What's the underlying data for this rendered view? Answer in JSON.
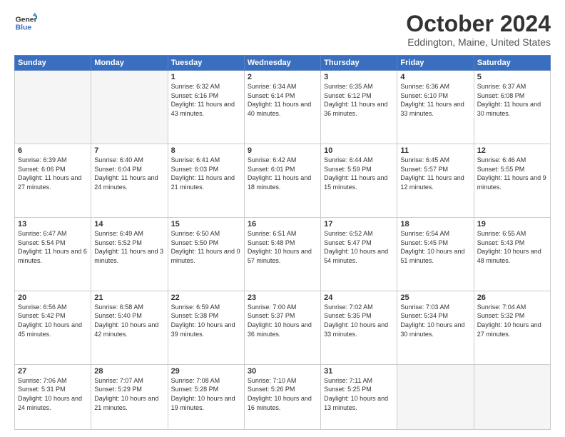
{
  "header": {
    "logo_line1": "General",
    "logo_line2": "Blue",
    "month": "October 2024",
    "location": "Eddington, Maine, United States"
  },
  "weekdays": [
    "Sunday",
    "Monday",
    "Tuesday",
    "Wednesday",
    "Thursday",
    "Friday",
    "Saturday"
  ],
  "weeks": [
    [
      {
        "day": "",
        "info": ""
      },
      {
        "day": "",
        "info": ""
      },
      {
        "day": "1",
        "info": "Sunrise: 6:32 AM\nSunset: 6:16 PM\nDaylight: 11 hours and 43 minutes."
      },
      {
        "day": "2",
        "info": "Sunrise: 6:34 AM\nSunset: 6:14 PM\nDaylight: 11 hours and 40 minutes."
      },
      {
        "day": "3",
        "info": "Sunrise: 6:35 AM\nSunset: 6:12 PM\nDaylight: 11 hours and 36 minutes."
      },
      {
        "day": "4",
        "info": "Sunrise: 6:36 AM\nSunset: 6:10 PM\nDaylight: 11 hours and 33 minutes."
      },
      {
        "day": "5",
        "info": "Sunrise: 6:37 AM\nSunset: 6:08 PM\nDaylight: 11 hours and 30 minutes."
      }
    ],
    [
      {
        "day": "6",
        "info": "Sunrise: 6:39 AM\nSunset: 6:06 PM\nDaylight: 11 hours and 27 minutes."
      },
      {
        "day": "7",
        "info": "Sunrise: 6:40 AM\nSunset: 6:04 PM\nDaylight: 11 hours and 24 minutes."
      },
      {
        "day": "8",
        "info": "Sunrise: 6:41 AM\nSunset: 6:03 PM\nDaylight: 11 hours and 21 minutes."
      },
      {
        "day": "9",
        "info": "Sunrise: 6:42 AM\nSunset: 6:01 PM\nDaylight: 11 hours and 18 minutes."
      },
      {
        "day": "10",
        "info": "Sunrise: 6:44 AM\nSunset: 5:59 PM\nDaylight: 11 hours and 15 minutes."
      },
      {
        "day": "11",
        "info": "Sunrise: 6:45 AM\nSunset: 5:57 PM\nDaylight: 11 hours and 12 minutes."
      },
      {
        "day": "12",
        "info": "Sunrise: 6:46 AM\nSunset: 5:55 PM\nDaylight: 11 hours and 9 minutes."
      }
    ],
    [
      {
        "day": "13",
        "info": "Sunrise: 6:47 AM\nSunset: 5:54 PM\nDaylight: 11 hours and 6 minutes."
      },
      {
        "day": "14",
        "info": "Sunrise: 6:49 AM\nSunset: 5:52 PM\nDaylight: 11 hours and 3 minutes."
      },
      {
        "day": "15",
        "info": "Sunrise: 6:50 AM\nSunset: 5:50 PM\nDaylight: 11 hours and 0 minutes."
      },
      {
        "day": "16",
        "info": "Sunrise: 6:51 AM\nSunset: 5:48 PM\nDaylight: 10 hours and 57 minutes."
      },
      {
        "day": "17",
        "info": "Sunrise: 6:52 AM\nSunset: 5:47 PM\nDaylight: 10 hours and 54 minutes."
      },
      {
        "day": "18",
        "info": "Sunrise: 6:54 AM\nSunset: 5:45 PM\nDaylight: 10 hours and 51 minutes."
      },
      {
        "day": "19",
        "info": "Sunrise: 6:55 AM\nSunset: 5:43 PM\nDaylight: 10 hours and 48 minutes."
      }
    ],
    [
      {
        "day": "20",
        "info": "Sunrise: 6:56 AM\nSunset: 5:42 PM\nDaylight: 10 hours and 45 minutes."
      },
      {
        "day": "21",
        "info": "Sunrise: 6:58 AM\nSunset: 5:40 PM\nDaylight: 10 hours and 42 minutes."
      },
      {
        "day": "22",
        "info": "Sunrise: 6:59 AM\nSunset: 5:38 PM\nDaylight: 10 hours and 39 minutes."
      },
      {
        "day": "23",
        "info": "Sunrise: 7:00 AM\nSunset: 5:37 PM\nDaylight: 10 hours and 36 minutes."
      },
      {
        "day": "24",
        "info": "Sunrise: 7:02 AM\nSunset: 5:35 PM\nDaylight: 10 hours and 33 minutes."
      },
      {
        "day": "25",
        "info": "Sunrise: 7:03 AM\nSunset: 5:34 PM\nDaylight: 10 hours and 30 minutes."
      },
      {
        "day": "26",
        "info": "Sunrise: 7:04 AM\nSunset: 5:32 PM\nDaylight: 10 hours and 27 minutes."
      }
    ],
    [
      {
        "day": "27",
        "info": "Sunrise: 7:06 AM\nSunset: 5:31 PM\nDaylight: 10 hours and 24 minutes."
      },
      {
        "day": "28",
        "info": "Sunrise: 7:07 AM\nSunset: 5:29 PM\nDaylight: 10 hours and 21 minutes."
      },
      {
        "day": "29",
        "info": "Sunrise: 7:08 AM\nSunset: 5:28 PM\nDaylight: 10 hours and 19 minutes."
      },
      {
        "day": "30",
        "info": "Sunrise: 7:10 AM\nSunset: 5:26 PM\nDaylight: 10 hours and 16 minutes."
      },
      {
        "day": "31",
        "info": "Sunrise: 7:11 AM\nSunset: 5:25 PM\nDaylight: 10 hours and 13 minutes."
      },
      {
        "day": "",
        "info": ""
      },
      {
        "day": "",
        "info": ""
      }
    ]
  ]
}
